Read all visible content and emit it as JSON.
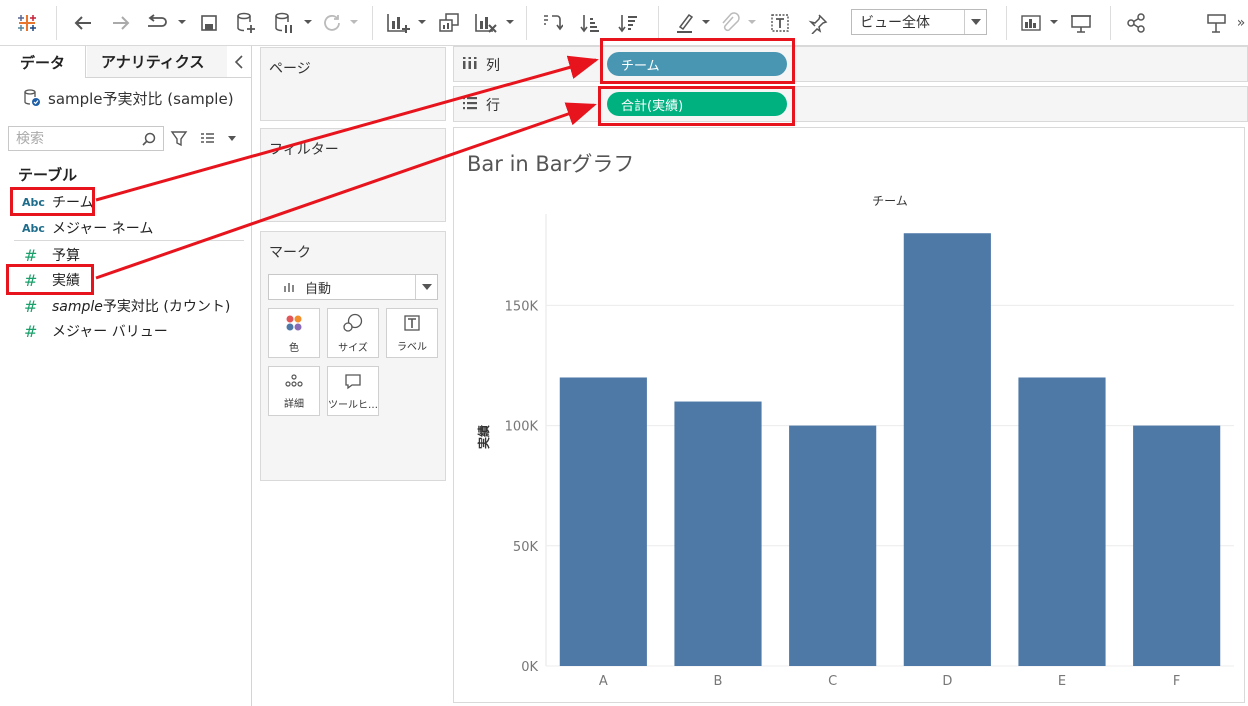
{
  "toolbar": {
    "view_select": "ビュー全体",
    "icons": [
      "tableau-logo-icon",
      "undo-icon",
      "redo-icon",
      "replay-icon",
      "save-icon",
      "new-datasource-icon",
      "pause-updates-icon",
      "refresh-icon",
      "new-worksheet-icon",
      "duplicate-icon",
      "clear-icon",
      "swap-icon",
      "sort-ascending-icon",
      "sort-descending-icon",
      "highlight-icon",
      "group-icon",
      "label-icon",
      "pin-icon",
      "show-me-icon",
      "presentation-icon",
      "share-icon",
      "show-cards-icon"
    ],
    "overflow": "»"
  },
  "data_pane": {
    "tabs": {
      "data": "データ",
      "analytics": "アナリティクス"
    },
    "collapse": "<",
    "datasource": "sample予実対比 (sample)",
    "search_placeholder": "検索",
    "section": "テーブル",
    "fields": [
      {
        "type": "Abc",
        "name": "チーム"
      },
      {
        "type": "Abc",
        "name": "メジャー ネーム"
      },
      {
        "type": "#",
        "name": "予算"
      },
      {
        "type": "#",
        "name": "実績"
      },
      {
        "type": "#",
        "name_italic": "sample",
        "name": "予実対比 (カウント)"
      },
      {
        "type": "#",
        "name": "メジャー バリュー"
      }
    ]
  },
  "cards": {
    "pages": "ページ",
    "filters": "フィルター",
    "marks": {
      "title": "マーク",
      "type": "自動",
      "buttons": [
        "色",
        "サイズ",
        "ラベル",
        "詳細",
        "ツールヒ…"
      ]
    }
  },
  "shelves": {
    "columns": {
      "label": "列",
      "pill": "チーム",
      "pill_color": "#4996b2"
    },
    "rows": {
      "label": "行",
      "pill": "合計(実績)",
      "pill_color": "#00b180"
    }
  },
  "viz": {
    "title": "Bar in Barグラフ"
  },
  "chart_data": {
    "type": "bar",
    "header": "チーム",
    "categories": [
      "A",
      "B",
      "C",
      "D",
      "E",
      "F"
    ],
    "values": [
      120000,
      110000,
      100000,
      180000,
      120000,
      100000
    ],
    "ylabel": "実績",
    "yticks": [
      "0K",
      "50K",
      "100K",
      "150K"
    ],
    "ytick_values": [
      0,
      50000,
      100000,
      150000
    ],
    "ylim": [
      0,
      188000
    ],
    "bar_color": "#4e79a7",
    "grid": true
  },
  "annotation_color": "#e8141d"
}
